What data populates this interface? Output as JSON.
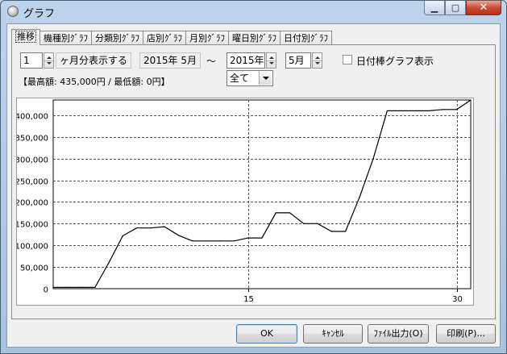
{
  "window": {
    "title": "グラフ",
    "icon": "app-disc-icon"
  },
  "tabs": [
    {
      "label": "推移",
      "active": true
    },
    {
      "label": "機種別ｸﾞﾗﾌ",
      "active": false
    },
    {
      "label": "分類別ｸﾞﾗﾌ",
      "active": false
    },
    {
      "label": "店別ｸﾞﾗﾌ",
      "active": false
    },
    {
      "label": "月別ｸﾞﾗﾌ",
      "active": false
    },
    {
      "label": "曜日別ｸﾞﾗﾌ",
      "active": false
    },
    {
      "label": "日付別ｸﾞﾗﾌ",
      "active": false
    }
  ],
  "controls": {
    "months_value": "1",
    "months_label": "ヶ月分表示する",
    "start_period": "2015年 5月",
    "range_sep": "～",
    "end_year": "2015年",
    "end_month": "5月",
    "bar_checkbox_label": "日付棒グラフ表示",
    "bar_checkbox_checked": false,
    "summary": "【最高額: 435,000円 / 最低額: 0円】",
    "filter_value": "全て"
  },
  "chart_data": {
    "type": "line",
    "xlabel": "",
    "ylabel": "",
    "xlim": [
      1,
      31
    ],
    "ylim": [
      0,
      435000
    ],
    "yticks": [
      0,
      50000,
      100000,
      150000,
      200000,
      250000,
      300000,
      350000,
      400000
    ],
    "ytick_labels": [
      "0",
      "50,000",
      "100,000",
      "150,000",
      "200,000",
      "250,000",
      "300,000",
      "350,000",
      "400,000"
    ],
    "xticks": [
      15,
      30
    ],
    "xtick_labels": [
      "15",
      "30"
    ],
    "grid": true,
    "series": [
      {
        "color": "#000000",
        "x": [
          1,
          2,
          3,
          4,
          5,
          6,
          7,
          8,
          9,
          10,
          11,
          12,
          13,
          14,
          15,
          16,
          17,
          18,
          19,
          20,
          21,
          22,
          23,
          24,
          25,
          26,
          27,
          28,
          29,
          30,
          31
        ],
        "y": [
          3000,
          3000,
          3000,
          3000,
          60000,
          122000,
          140000,
          140000,
          143000,
          123000,
          110000,
          110000,
          110000,
          110000,
          117000,
          117000,
          175000,
          175000,
          150000,
          150000,
          132000,
          132000,
          210000,
          300000,
          410000,
          410000,
          410000,
          410000,
          413000,
          413000,
          435000
        ]
      }
    ]
  },
  "buttons": {
    "ok": "OK",
    "cancel": "ｷｬﾝｾﾙ",
    "file_output": "ﾌｧｲﾙ出力(O)",
    "print": "印刷(P)..."
  }
}
